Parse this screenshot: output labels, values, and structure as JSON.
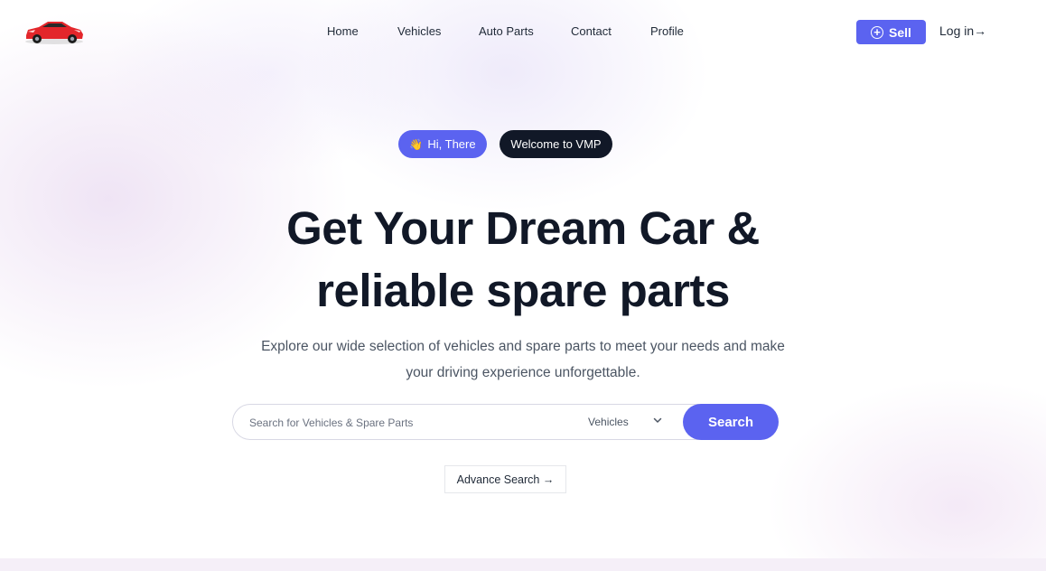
{
  "header": {
    "logo_icon": "red-sports-car-icon",
    "nav": {
      "home": "Home",
      "vehicles": "Vehicles",
      "auto_parts": "Auto Parts",
      "contact": "Contact",
      "profile": "Profile"
    },
    "sell_label": "Sell",
    "sell_icon": "plus-circle-icon",
    "login_label": "Log in→"
  },
  "hero": {
    "pill_hi_icon": "waving-hand-icon",
    "pill_hi_label": "Hi, There",
    "pill_welcome_label": "Welcome to VMP",
    "title_line1": "Get Your Dream Car &",
    "title_line2": "reliable spare parts",
    "subtitle_line1": "Explore our wide selection of vehicles and spare parts to meet your needs and make",
    "subtitle_line2": "your driving experience unforgettable."
  },
  "search": {
    "placeholder": "Search for Vehicles & Spare Parts",
    "value": "",
    "category_selected": "Vehicles",
    "button_label": "Search",
    "advance_label": "Advance Search →"
  },
  "colors": {
    "accent": "#5b63f0",
    "dark": "#111827",
    "logo_red": "#e3262b"
  }
}
